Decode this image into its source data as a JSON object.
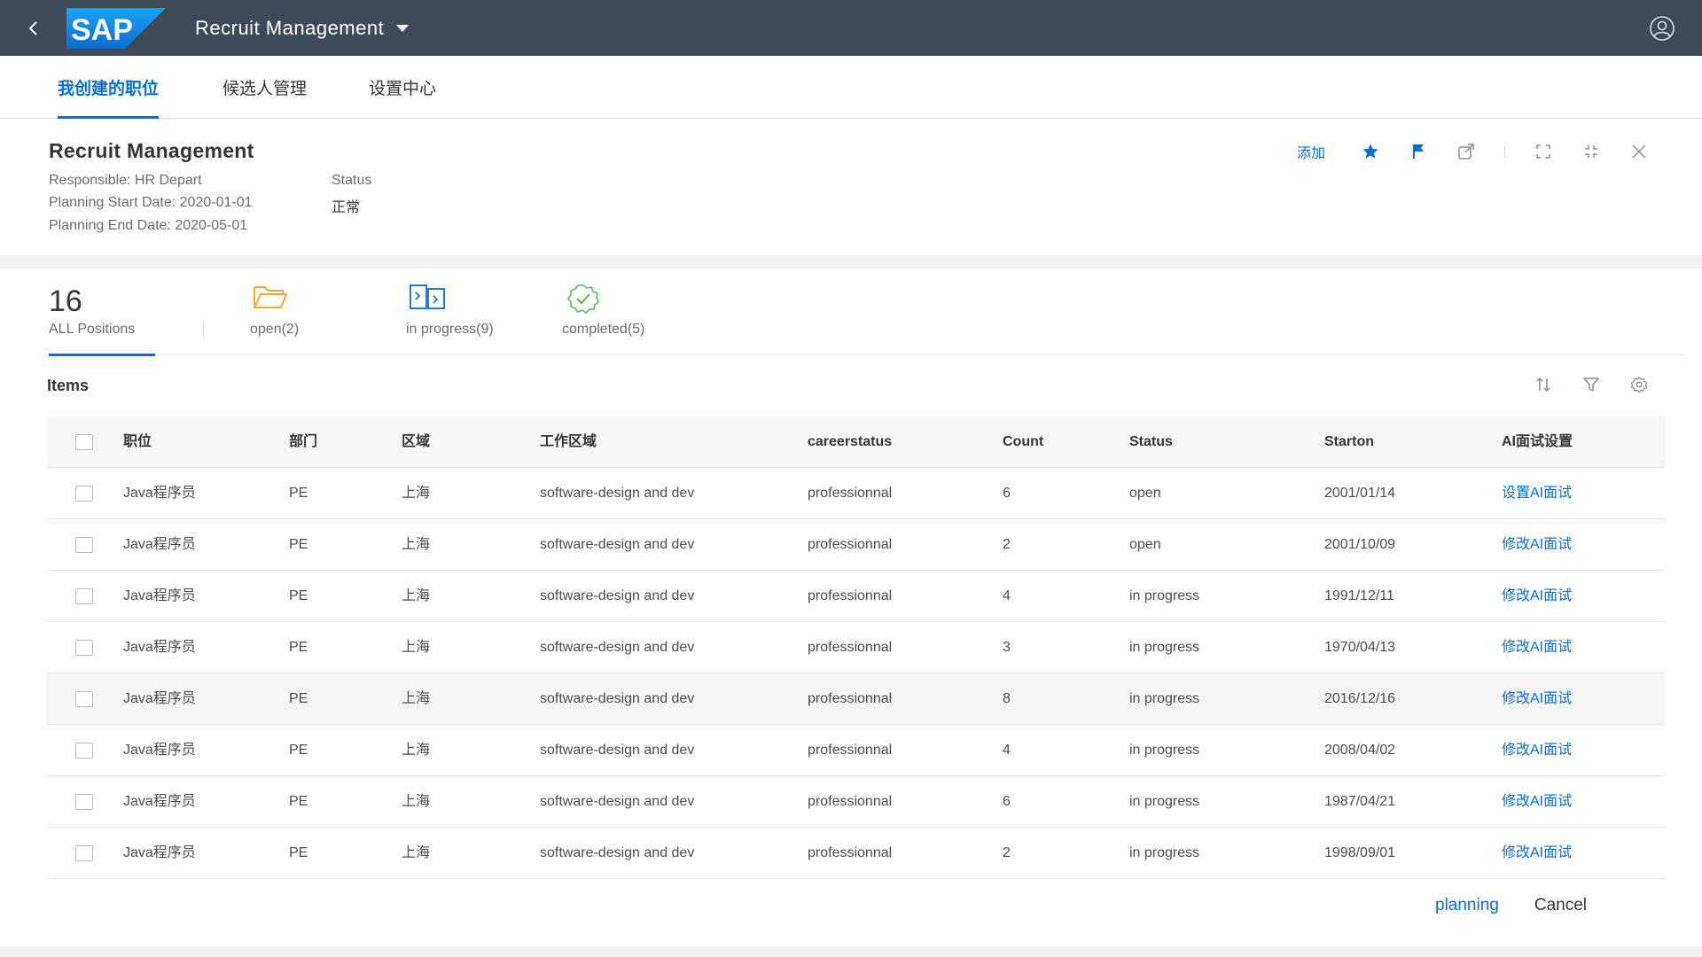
{
  "shell": {
    "brand": "SAP",
    "app_title": "Recruit Management",
    "colors": {
      "shell_bg": "#3f4a58",
      "brand_blue": "#0a6ed1"
    }
  },
  "tabs": [
    {
      "label": "我创建的职位",
      "active": true
    },
    {
      "label": "候选人管理",
      "active": false
    },
    {
      "label": "设置中心",
      "active": false
    }
  ],
  "header": {
    "title": "Recruit Management",
    "responsible": "Responsible: HR Depart",
    "start_date": "Planning Start Date: 2020-01-01",
    "end_date": "Planning End Date: 2020-05-01",
    "status_label": "Status",
    "status_value": "正常",
    "add_label": "添加",
    "icons": [
      "star-icon",
      "flag-icon",
      "share-icon",
      "fullscreen-icon",
      "exit-fullscreen-icon",
      "close-icon"
    ]
  },
  "kpis": {
    "all_count": "16",
    "all_label": "ALL Positions",
    "open_label": "open(2)",
    "progress_label": "in progress(9)",
    "completed_label": "completed(5)"
  },
  "items": {
    "title": "Items",
    "columns": [
      "职位",
      "部门",
      "区域",
      "工作区域",
      "careerstatus",
      "Count",
      "Status",
      "Starton",
      "AI面试设置"
    ],
    "rows": [
      {
        "position": "Java程序员",
        "dept": "PE",
        "region": "上海",
        "work_area": "software-design and dev",
        "career": "professionnal",
        "count": "6",
        "status": "open",
        "start": "2001/01/14",
        "ai": "设置AI面试"
      },
      {
        "position": "Java程序员",
        "dept": "PE",
        "region": "上海",
        "work_area": "software-design and dev",
        "career": "professionnal",
        "count": "2",
        "status": "open",
        "start": "2001/10/09",
        "ai": "修改AI面试"
      },
      {
        "position": "Java程序员",
        "dept": "PE",
        "region": "上海",
        "work_area": "software-design and dev",
        "career": "professionnal",
        "count": "4",
        "status": "in progress",
        "start": "1991/12/11",
        "ai": "修改AI面试"
      },
      {
        "position": "Java程序员",
        "dept": "PE",
        "region": "上海",
        "work_area": "software-design and dev",
        "career": "professionnal",
        "count": "3",
        "status": "in progress",
        "start": "1970/04/13",
        "ai": "修改AI面试"
      },
      {
        "position": "Java程序员",
        "dept": "PE",
        "region": "上海",
        "work_area": "software-design and dev",
        "career": "professionnal",
        "count": "8",
        "status": "in progress",
        "start": "2016/12/16",
        "ai": "修改AI面试"
      },
      {
        "position": "Java程序员",
        "dept": "PE",
        "region": "上海",
        "work_area": "software-design and dev",
        "career": "professionnal",
        "count": "4",
        "status": "in progress",
        "start": "2008/04/02",
        "ai": "修改AI面试"
      },
      {
        "position": "Java程序员",
        "dept": "PE",
        "region": "上海",
        "work_area": "software-design and dev",
        "career": "professionnal",
        "count": "6",
        "status": "in progress",
        "start": "1987/04/21",
        "ai": "修改AI面试"
      },
      {
        "position": "Java程序员",
        "dept": "PE",
        "region": "上海",
        "work_area": "software-design and dev",
        "career": "professionnal",
        "count": "2",
        "status": "in progress",
        "start": "1998/09/01",
        "ai": "修改AI面试"
      }
    ]
  },
  "footer": {
    "planning_label": "planning",
    "cancel_label": "Cancel"
  }
}
